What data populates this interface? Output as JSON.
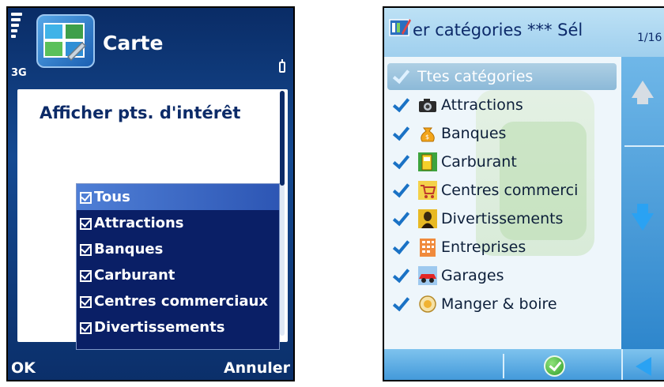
{
  "left_screen": {
    "network": "3G",
    "title": "Carte",
    "heading": "Afficher pts. d'intérêt",
    "items": [
      {
        "label": "Tous",
        "checked": true,
        "highlighted": true
      },
      {
        "label": "Attractions",
        "checked": true,
        "highlighted": false
      },
      {
        "label": "Banques",
        "checked": true,
        "highlighted": false
      },
      {
        "label": "Carburant",
        "checked": true,
        "highlighted": false
      },
      {
        "label": "Centres commerciaux",
        "checked": true,
        "highlighted": false
      },
      {
        "label": "Divertissements",
        "checked": true,
        "highlighted": false
      }
    ],
    "softkeys": {
      "left": "OK",
      "right": "Annuler"
    }
  },
  "right_screen": {
    "title": "er catégories *** Sél",
    "page_indicator": "1/16",
    "all_label": "Ttes catégories",
    "categories": [
      {
        "label": "Attractions",
        "icon": "camera-icon"
      },
      {
        "label": "Banques",
        "icon": "money-bag-icon"
      },
      {
        "label": "Carburant",
        "icon": "fuel-pump-icon"
      },
      {
        "label": "Centres commerci",
        "icon": "shopping-cart-icon"
      },
      {
        "label": "Divertissements",
        "icon": "mona-lisa-icon"
      },
      {
        "label": "Entreprises",
        "icon": "building-icon"
      },
      {
        "label": "Garages",
        "icon": "car-icon"
      },
      {
        "label": "Manger & boire",
        "icon": "food-icon"
      }
    ]
  },
  "colors": {
    "left_bg": "#0a2c66",
    "left_list_bg": "#0a1f66",
    "left_highlight": "#4f7fd6",
    "right_titlebar": "#9fcfee",
    "right_nav": "#2e86cc",
    "check_blue": "#1a72c5"
  }
}
